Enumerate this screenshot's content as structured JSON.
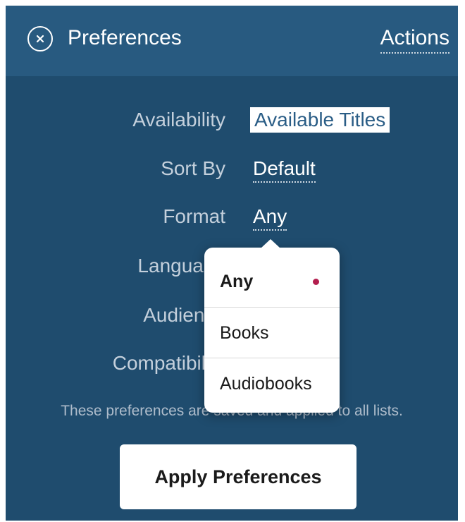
{
  "header": {
    "title": "Preferences",
    "actions_label": "Actions",
    "close_icon": "close-circle-icon"
  },
  "form": {
    "rows": [
      {
        "label": "Availability",
        "value": "Available Titles"
      },
      {
        "label": "Sort By",
        "value": "Default"
      },
      {
        "label": "Format",
        "value": "Any"
      },
      {
        "label": "Language",
        "value": ""
      },
      {
        "label": "Audience",
        "value": ""
      },
      {
        "label": "Compatibility",
        "value": ""
      }
    ],
    "note": "These preferences are saved and applied to all lists."
  },
  "apply_button": {
    "label": "Apply Preferences"
  },
  "format_popover": {
    "options": [
      "Any",
      "Books",
      "Audiobooks"
    ],
    "selected": "Any",
    "selected_indicator_color": "#b31e4e"
  },
  "colors": {
    "background": "#1f4c6e",
    "header": "#285a80",
    "accent": "#2a5d86"
  }
}
